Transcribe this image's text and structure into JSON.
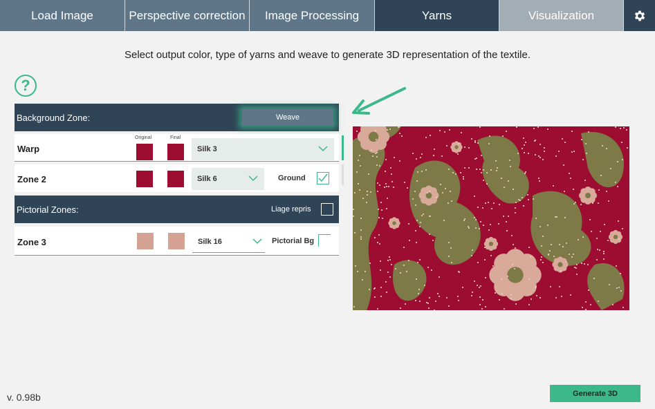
{
  "tabs": [
    {
      "label": "Load Image"
    },
    {
      "label": "Perspective correction"
    },
    {
      "label": "Image Processing"
    },
    {
      "label": "Yarns"
    },
    {
      "label": "Visualization"
    }
  ],
  "settings_icon": "gear-icon",
  "instruction": "Select output color, type of yarns and weave to generate 3D representation of the textile.",
  "help_icon": "question-circle-icon",
  "background_zone": {
    "title": "Background Zone:",
    "weave_button": "Weave",
    "col_original": "Original",
    "col_final": "Final",
    "rows": [
      {
        "label": "Warp",
        "original_color": "#9c0d31",
        "final_color": "#9c0d31",
        "yarn": "Silk 3"
      },
      {
        "label": "Zone 2",
        "original_color": "#9c0d31",
        "final_color": "#9c0d31",
        "yarn": "Silk 6",
        "extra_label": "Ground",
        "extra_checked": true
      }
    ]
  },
  "pictorial_zones": {
    "title": "Pictorial Zones:",
    "liage_label": "Liage repris",
    "liage_checked": false,
    "rows": [
      {
        "label": "Zone 3",
        "original_color": "#d4a393",
        "final_color": "#d4a393",
        "yarn": "Silk 16",
        "extra_label": "Pictorial Bg",
        "extra_checked": false
      }
    ]
  },
  "textile_colors": {
    "ground": "#9c0d31",
    "olive": "#7d7a48",
    "pink": "#d9a99a",
    "light": "#e9cbc0"
  },
  "accent_color": "#3cb88a",
  "header_color": "#2f4557",
  "version": "v. 0.98b",
  "generate_button": "Generate 3D"
}
